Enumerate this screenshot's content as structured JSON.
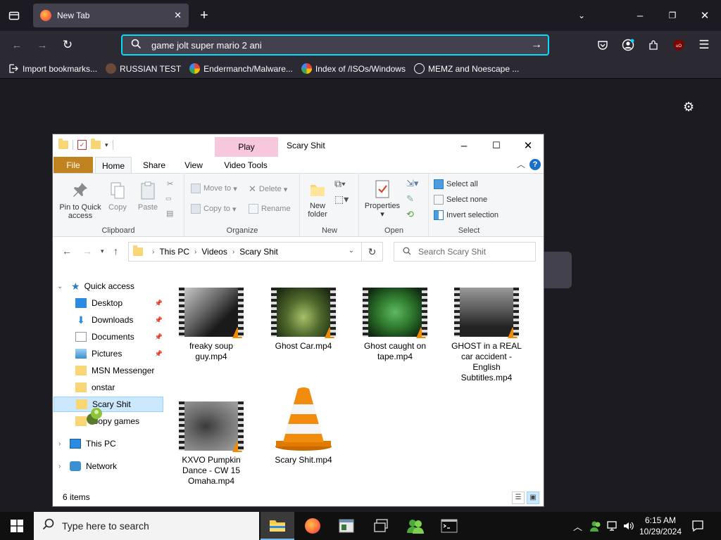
{
  "browser": {
    "tab_title": "New Tab",
    "url_text": "game jolt super mario 2 ani",
    "bookmarks": [
      {
        "label": "Import bookmarks..."
      },
      {
        "label": "RUSSIAN TEST"
      },
      {
        "label": "Endermanch/Malware..."
      },
      {
        "label": "Index of /ISOs/Windows"
      },
      {
        "label": "MEMZ and Noescape ..."
      }
    ],
    "accent": "#00ddff"
  },
  "explorer": {
    "context_tab": "Play",
    "title": "Scary Shit",
    "ribbon_tabs": {
      "file": "File",
      "home": "Home",
      "share": "Share",
      "view": "View",
      "video_tools": "Video Tools"
    },
    "clipboard": {
      "pin": "Pin to Quick access",
      "copy": "Copy",
      "paste": "Paste",
      "group": "Clipboard"
    },
    "organize": {
      "move_to": "Move to",
      "copy_to": "Copy to",
      "delete": "Delete",
      "rename": "Rename",
      "group": "Organize"
    },
    "new": {
      "new_folder": "New folder",
      "group": "New"
    },
    "open": {
      "properties": "Properties",
      "group": "Open"
    },
    "select": {
      "select_all": "Select all",
      "select_none": "Select none",
      "invert": "Invert selection",
      "group": "Select"
    },
    "breadcrumb": [
      "This PC",
      "Videos",
      "Scary Shit"
    ],
    "search_placeholder": "Search Scary Shit",
    "nav": {
      "quick_access": "Quick access",
      "items": [
        {
          "label": "Desktop"
        },
        {
          "label": "Downloads"
        },
        {
          "label": "Documents"
        },
        {
          "label": "Pictures"
        },
        {
          "label": "MSN Messenger"
        },
        {
          "label": "onstar"
        },
        {
          "label": "Scary Shit"
        },
        {
          "label": "loopy games"
        }
      ],
      "this_pc": "This PC",
      "network": "Network"
    },
    "files": [
      {
        "name": "freaky soup guy.mp4"
      },
      {
        "name": "Ghost Car.mp4"
      },
      {
        "name": "Ghost caught on tape.mp4"
      },
      {
        "name": "GHOST in a REAL car accident - English Subtitles.mp4"
      },
      {
        "name": "KXVO Pumpkin Dance - CW 15 Omaha.mp4"
      },
      {
        "name": "Scary Shit.mp4"
      }
    ],
    "status": "6 items",
    "file_accent": "#c18220"
  },
  "taskbar": {
    "search_placeholder": "Type here to search",
    "time": "6:15 AM",
    "date": "10/29/2024"
  }
}
